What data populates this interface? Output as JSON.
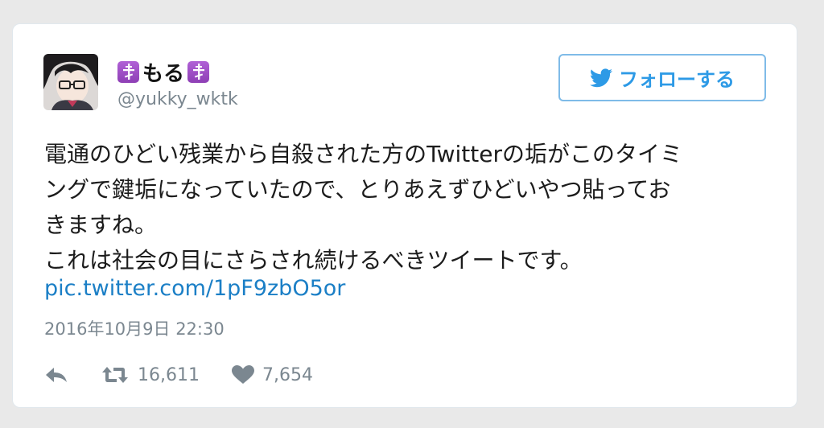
{
  "tweet": {
    "display_name": "もる",
    "handle": "@yukky_wktk",
    "follow_label": "フォローする",
    "text_lines": [
      "電通のひどい残業から自殺された方のTwitterの垢がこのタイミ",
      "ングで鍵垢になっていたので、とりあえずひどいやつ貼ってお",
      "きますね。",
      "これは社会の目にさらされ続けるべきツイートです。"
    ],
    "pic_link": "pic.twitter.com/1pF9zbO5or",
    "timestamp": "2016年10月9日 22:30",
    "retweet_count": "16,611",
    "like_count": "7,654"
  },
  "icons": {
    "name_badges": "orthodox-cross-icon",
    "follow": "twitter-bird-icon",
    "reply": "reply-icon",
    "retweet": "retweet-icon",
    "like": "heart-icon"
  },
  "colors": {
    "link": "#1b7fc6",
    "follow_border": "#7fbbe8",
    "badge": "#9b4fc7",
    "muted": "#7b8790"
  }
}
